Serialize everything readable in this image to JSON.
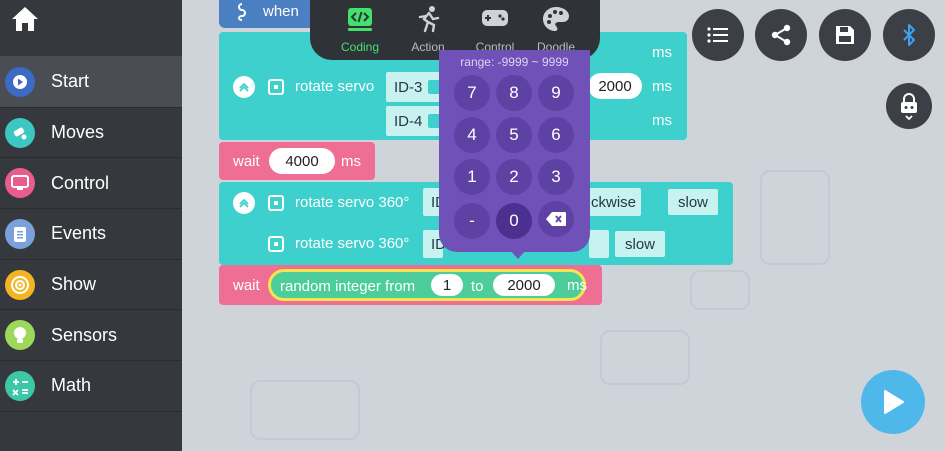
{
  "sidebar": {
    "items": [
      {
        "label": "Start",
        "color": "#3d6bc4"
      },
      {
        "label": "Moves",
        "color": "#3dc7c3"
      },
      {
        "label": "Control",
        "color": "#e95c8e"
      },
      {
        "label": "Events",
        "color": "#7aa1dc"
      },
      {
        "label": "Show",
        "color": "#f2b624"
      },
      {
        "label": "Sensors",
        "color": "#9ed85a"
      },
      {
        "label": "Math",
        "color": "#3dc7a6"
      }
    ]
  },
  "tabs": [
    {
      "label": "Coding",
      "icon": "coding-icon",
      "active": true
    },
    {
      "label": "Action",
      "icon": "action-icon",
      "active": false
    },
    {
      "label": "Control",
      "icon": "gamepad-icon",
      "active": false
    },
    {
      "label": "Doodle",
      "icon": "palette-icon",
      "active": false
    }
  ],
  "blocks": {
    "when_label": "when",
    "ms_label": "ms",
    "rotate_servo": {
      "label": "rotate servo",
      "id3": "ID-3",
      "id4": "ID-4",
      "time_value": "2000",
      "ms": "ms"
    },
    "wait1": {
      "label": "wait",
      "value": "4000",
      "ms": "ms"
    },
    "rotate_360_a": {
      "label": "rotate servo 360°",
      "id": "ID",
      "direction": "ckwise",
      "speed": "slow"
    },
    "rotate_360_b": {
      "label": "rotate servo 360°",
      "id": "ID",
      "speed": "slow"
    },
    "wait2": {
      "label": "wait",
      "random_label": "random integer from",
      "from": "1",
      "to_label": "to",
      "to": "2000",
      "ms": "ms"
    }
  },
  "keypad": {
    "range": "range: -9999 ~ 9999",
    "keys": [
      "7",
      "8",
      "9",
      "4",
      "5",
      "6",
      "1",
      "2",
      "3",
      "-",
      "0"
    ],
    "delete_icon": "backspace-icon"
  },
  "right_buttons": [
    "list-icon",
    "share-icon",
    "save-icon",
    "bluetooth-icon",
    "lock-icon"
  ],
  "colors": {
    "teal": "#3dd0cc",
    "pink": "#ee6f93",
    "keypad": "#7051b8",
    "play": "#4fb8ea",
    "active_tab": "#43e06e"
  }
}
